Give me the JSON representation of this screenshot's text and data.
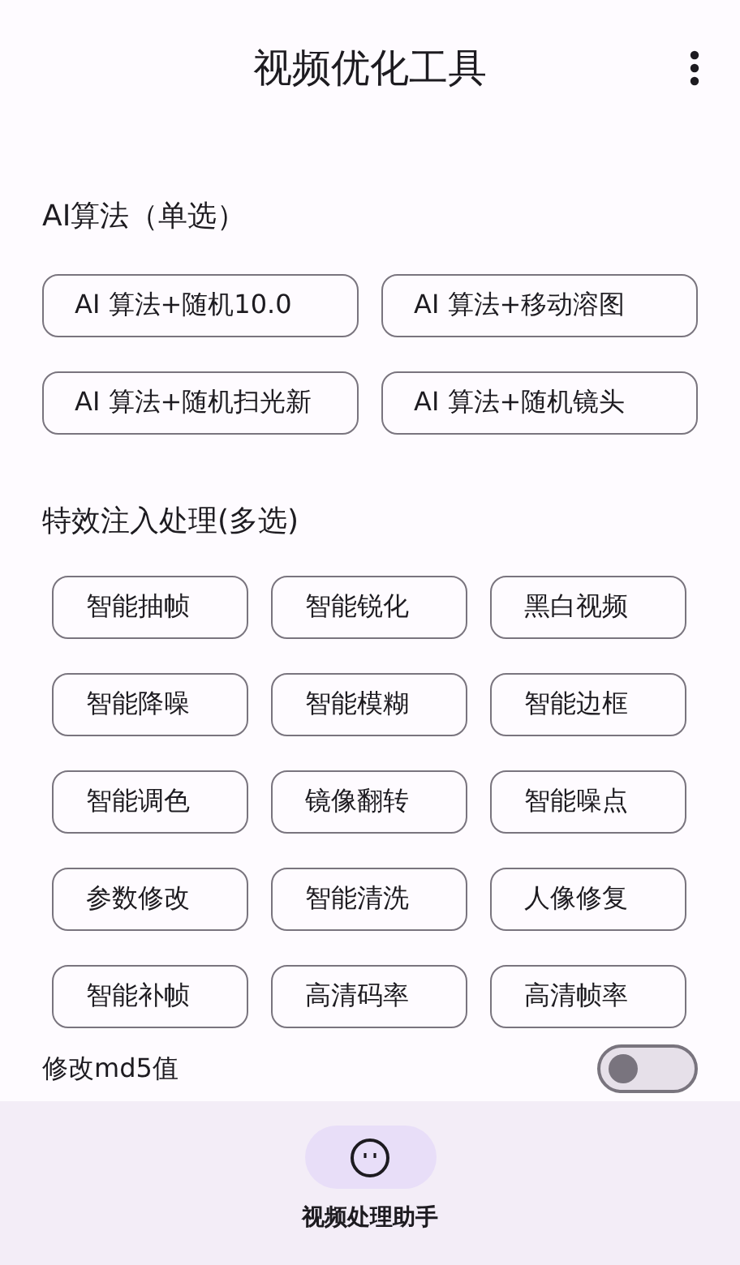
{
  "app_bar": {
    "title": "视频优化工具"
  },
  "algorithm_section": {
    "title": "AI算法（单选）",
    "options": [
      {
        "label": "AI 算法+随机10.0",
        "selected": false
      },
      {
        "label": "AI 算法+移动溶图",
        "selected": false
      },
      {
        "label": "AI 算法+随机扫光新",
        "selected": false
      },
      {
        "label": "AI 算法+随机镜头",
        "selected": false
      }
    ]
  },
  "effects_section": {
    "title": "特效注入处理(多选)",
    "options": [
      {
        "label": "智能抽帧",
        "selected": false
      },
      {
        "label": "智能锐化",
        "selected": false
      },
      {
        "label": "黑白视频",
        "selected": false
      },
      {
        "label": "智能降噪",
        "selected": false
      },
      {
        "label": "智能模糊",
        "selected": false
      },
      {
        "label": "智能边框",
        "selected": false
      },
      {
        "label": "智能调色",
        "selected": false
      },
      {
        "label": "镜像翻转",
        "selected": false
      },
      {
        "label": "智能噪点",
        "selected": false
      },
      {
        "label": "参数修改",
        "selected": false
      },
      {
        "label": "智能清洗",
        "selected": false
      },
      {
        "label": "人像修复",
        "selected": false
      },
      {
        "label": "智能补帧",
        "selected": false
      },
      {
        "label": "高清码率",
        "selected": false
      },
      {
        "label": "高清帧率",
        "selected": false
      }
    ]
  },
  "md5_toggle": {
    "label": "修改md5值",
    "on": false
  },
  "bottom_nav": {
    "items": [
      {
        "label": "视频处理助手",
        "selected": true
      }
    ]
  }
}
